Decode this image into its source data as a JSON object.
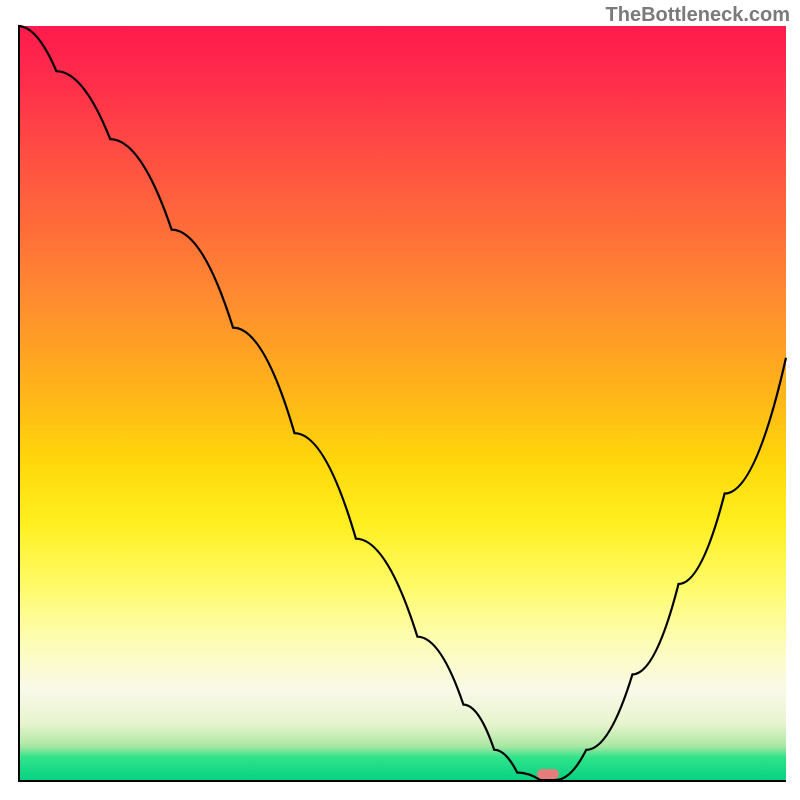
{
  "watermark": "TheBottleneck.com",
  "colors": {
    "curve": "#000000",
    "axis": "#000000",
    "marker": "#e77d7a"
  },
  "chart_data": {
    "type": "line",
    "title": "",
    "xlabel": "",
    "ylabel": "",
    "xlim": [
      0,
      100
    ],
    "ylim": [
      0,
      100
    ],
    "grid": false,
    "series": [
      {
        "name": "bottleneck-curve",
        "x": [
          0,
          5,
          12,
          20,
          28,
          36,
          44,
          52,
          58,
          62,
          65,
          68,
          70,
          74,
          80,
          86,
          92,
          100
        ],
        "values": [
          100,
          94,
          85,
          73,
          60,
          46,
          32,
          19,
          10,
          4,
          1,
          0,
          0,
          4,
          14,
          26,
          38,
          56
        ]
      }
    ],
    "annotations": [
      {
        "name": "optimal-marker",
        "x": 69,
        "y": 0.8
      }
    ],
    "gradient_stops": [
      {
        "pos": 0,
        "color": "#ff1a4d"
      },
      {
        "pos": 0.26,
        "color": "#ff6a3a"
      },
      {
        "pos": 0.58,
        "color": "#ffd80a"
      },
      {
        "pos": 0.88,
        "color": "#f8f9e8"
      },
      {
        "pos": 1.0,
        "color": "#07d281"
      }
    ]
  }
}
